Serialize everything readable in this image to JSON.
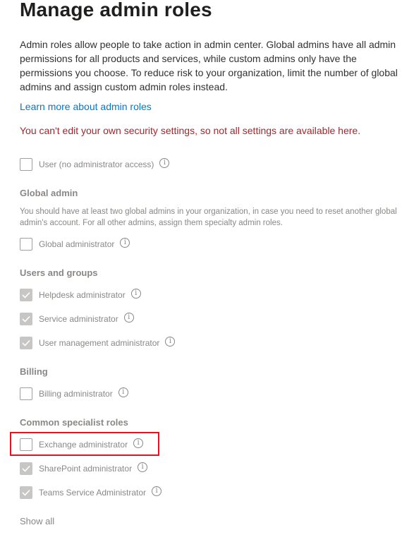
{
  "page": {
    "title": "Manage admin roles",
    "description": "Admin roles allow people to take action in admin center. Global admins have all admin permissions for all products and services, while custom admins only have the permissions you choose. To reduce risk to your organization, limit the number of global admins and assign custom admin roles instead.",
    "learn_more_link": "Learn more about admin roles",
    "warning": "You can't edit your own security settings, so not all settings are available here.",
    "show_all": "Show all"
  },
  "user_role": {
    "label": "User (no administrator access)",
    "checked": false
  },
  "global_admin": {
    "heading": "Global admin",
    "note": "You should have at least two global admins in your organization, in case you need to reset another global admin's account. For all other admins, assign them specialty admin roles.",
    "roles": [
      {
        "label": "Global administrator",
        "checked": false
      }
    ]
  },
  "users_and_groups": {
    "heading": "Users and groups",
    "roles": [
      {
        "label": "Helpdesk administrator",
        "checked": true
      },
      {
        "label": "Service administrator",
        "checked": true
      },
      {
        "label": "User management administrator",
        "checked": true
      }
    ]
  },
  "billing": {
    "heading": "Billing",
    "roles": [
      {
        "label": "Billing administrator",
        "checked": false
      }
    ]
  },
  "common_specialist": {
    "heading": "Common specialist roles",
    "roles": [
      {
        "label": "Exchange administrator",
        "checked": false
      },
      {
        "label": "SharePoint administrator",
        "checked": true
      },
      {
        "label": "Teams Service Administrator",
        "checked": true
      }
    ]
  },
  "icons": {
    "info": "info-icon",
    "check": "checkmark-icon"
  },
  "colors": {
    "link": "#0078d4",
    "warning": "#a4262c",
    "highlight": "#e81123",
    "muted": "#8a8886"
  }
}
